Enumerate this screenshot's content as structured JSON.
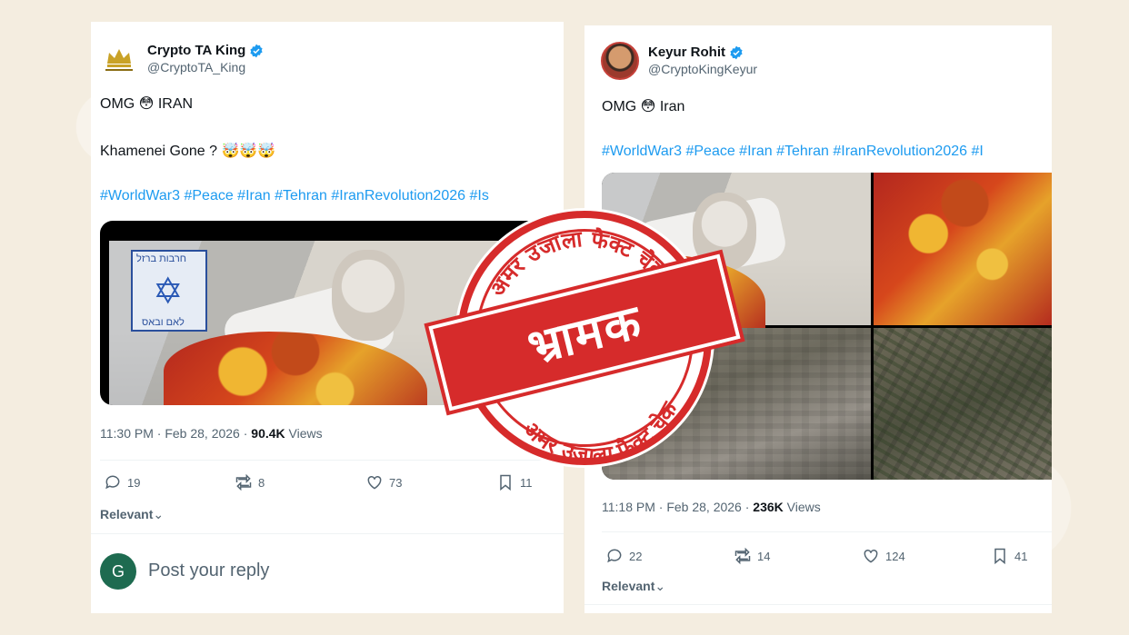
{
  "tweets": [
    {
      "display_name": "Crypto TA King",
      "handle": "@CryptoTA_King",
      "text_line1": "OMG",
      "emoji1": "😳",
      "text_line1b": "IRAN",
      "text_line2": "Khamenei Gone ?",
      "emoji2": "🤯🤯🤯",
      "hashtags": "#WorldWar3 #Peace #Iran #Tehran #IranRevolution2026 #Is",
      "meta_time": "11:30 PM · Feb 28, 2026 · ",
      "meta_views": "90.4K",
      "meta_views_label": " Views",
      "replies": "19",
      "reposts": "8",
      "likes": "73",
      "bookmarks": "11",
      "relevant": "Relevant",
      "sign_top": "חרבות ברזל",
      "sign_bottom": "לאם ובאס",
      "reply_initial": "G",
      "reply_placeholder": "Post your reply"
    },
    {
      "display_name": "Keyur Rohit",
      "handle": "@CryptoKingKeyur",
      "text_line1": "OMG",
      "emoji1": "😳",
      "text_line1b": "Iran",
      "hashtags": "#WorldWar3 #Peace #Iran #Tehran #IranRevolution2026 #I",
      "meta_time": "11:18 PM · Feb 28, 2026 · ",
      "meta_views": "236K",
      "meta_views_label": " Views",
      "replies": "22",
      "reposts": "14",
      "likes": "124",
      "bookmarks": "41",
      "relevant": "Relevant"
    }
  ],
  "stamp": {
    "label": "भ्रामक",
    "arc_top": "अमर उजाला फैक्ट चेक",
    "arc_bottom": "अमर उजाला फैक्ट चेक",
    "color": "#d62b2b"
  },
  "colors": {
    "link": "#1d9bf0",
    "verified": "#1d9bf0",
    "muted": "#536471"
  }
}
